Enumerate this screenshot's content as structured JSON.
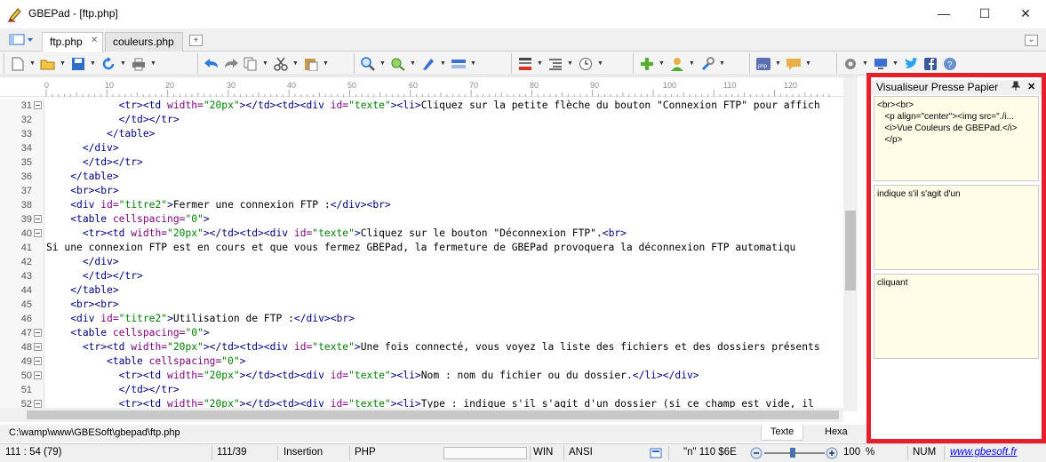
{
  "window": {
    "title": "GBEPad - [ftp.php]",
    "minimize_glyph": "—",
    "maximize_glyph": "☐",
    "close_glyph": "✕"
  },
  "tabs": [
    {
      "label": "ftp.php",
      "active": true,
      "close": "✕"
    },
    {
      "label": "couleurs.php",
      "active": false
    }
  ],
  "tab_add_glyph": "+",
  "tab_menu_glyph": "⌄",
  "ruler": {
    "marks": [
      "0",
      "10",
      "20",
      "30",
      "40",
      "50",
      "60",
      "70",
      "80",
      "90",
      "100",
      "110",
      "120"
    ]
  },
  "lines": [
    {
      "n": "31",
      "fold": true,
      "indent": "            ",
      "segments": [
        [
          "t",
          "<tr><td "
        ],
        [
          "a",
          "width="
        ],
        [
          "v",
          "\"20px\""
        ],
        [
          "t",
          "></td><td><div "
        ],
        [
          "a",
          "id="
        ],
        [
          "v",
          "\"texte\""
        ],
        [
          "t",
          "><li>"
        ],
        [
          "x",
          "Cliquez sur la petite flèche du bouton \"Connexion FTP\" pour affich"
        ]
      ]
    },
    {
      "n": "32",
      "fold": false,
      "indent": "            ",
      "segments": [
        [
          "t",
          "</td></tr>"
        ]
      ]
    },
    {
      "n": "33",
      "fold": false,
      "indent": "          ",
      "segments": [
        [
          "t",
          "</table>"
        ]
      ]
    },
    {
      "n": "34",
      "fold": false,
      "indent": "      ",
      "segments": [
        [
          "t",
          "</div>"
        ]
      ]
    },
    {
      "n": "35",
      "fold": false,
      "indent": "      ",
      "segments": [
        [
          "t",
          "</td></tr>"
        ]
      ]
    },
    {
      "n": "36",
      "fold": false,
      "indent": "    ",
      "segments": [
        [
          "t",
          "</table>"
        ]
      ]
    },
    {
      "n": "37",
      "fold": false,
      "indent": "    ",
      "segments": [
        [
          "t",
          "<br><br>"
        ]
      ]
    },
    {
      "n": "38",
      "fold": false,
      "indent": "    ",
      "segments": [
        [
          "t",
          "<div "
        ],
        [
          "a",
          "id="
        ],
        [
          "v",
          "\"titre2\""
        ],
        [
          "t",
          ">"
        ],
        [
          "x",
          "Fermer une connexion FTP :"
        ],
        [
          "t",
          "</div><br>"
        ]
      ]
    },
    {
      "n": "39",
      "fold": true,
      "indent": "    ",
      "segments": [
        [
          "t",
          "<table "
        ],
        [
          "a",
          "cellspacing="
        ],
        [
          "v",
          "\"0\""
        ],
        [
          "t",
          ">"
        ]
      ]
    },
    {
      "n": "40",
      "fold": true,
      "indent": "      ",
      "segments": [
        [
          "t",
          "<tr><td "
        ],
        [
          "a",
          "width="
        ],
        [
          "v",
          "\"20px\""
        ],
        [
          "t",
          "></td><td><div "
        ],
        [
          "a",
          "id="
        ],
        [
          "v",
          "\"texte\""
        ],
        [
          "t",
          ">"
        ],
        [
          "x",
          "Cliquez sur le bouton \"Déconnexion FTP\"."
        ],
        [
          "t",
          "<br>"
        ]
      ]
    },
    {
      "n": "41",
      "fold": false,
      "indent": "",
      "segments": [
        [
          "x",
          "Si une connexion FTP est en cours et que vous fermez GBEPad, la fermeture de GBEPad provoquera la déconnexion FTP automatiqu"
        ]
      ]
    },
    {
      "n": "42",
      "fold": false,
      "indent": "      ",
      "segments": [
        [
          "t",
          "</div>"
        ]
      ]
    },
    {
      "n": "43",
      "fold": false,
      "indent": "      ",
      "segments": [
        [
          "t",
          "</td></tr>"
        ]
      ]
    },
    {
      "n": "44",
      "fold": false,
      "indent": "    ",
      "segments": [
        [
          "t",
          "</table>"
        ]
      ]
    },
    {
      "n": "45",
      "fold": false,
      "indent": "    ",
      "segments": [
        [
          "t",
          "<br><br>"
        ]
      ]
    },
    {
      "n": "46",
      "fold": false,
      "indent": "    ",
      "segments": [
        [
          "t",
          "<div "
        ],
        [
          "a",
          "id="
        ],
        [
          "v",
          "\"titre2\""
        ],
        [
          "t",
          ">"
        ],
        [
          "x",
          "Utilisation de FTP :"
        ],
        [
          "t",
          "</div><br>"
        ]
      ]
    },
    {
      "n": "47",
      "fold": true,
      "indent": "    ",
      "segments": [
        [
          "t",
          "<table "
        ],
        [
          "a",
          "cellspacing="
        ],
        [
          "v",
          "\"0\""
        ],
        [
          "t",
          ">"
        ]
      ]
    },
    {
      "n": "48",
      "fold": true,
      "indent": "      ",
      "segments": [
        [
          "t",
          "<tr><td "
        ],
        [
          "a",
          "width="
        ],
        [
          "v",
          "\"20px\""
        ],
        [
          "t",
          "></td><td><div "
        ],
        [
          "a",
          "id="
        ],
        [
          "v",
          "\"texte\""
        ],
        [
          "t",
          ">"
        ],
        [
          "x",
          "Une fois connecté, vous voyez la liste des fichiers et des dossiers présents"
        ]
      ]
    },
    {
      "n": "49",
      "fold": true,
      "indent": "          ",
      "segments": [
        [
          "t",
          "<table "
        ],
        [
          "a",
          "cellspacing="
        ],
        [
          "v",
          "\"0\""
        ],
        [
          "t",
          ">"
        ]
      ]
    },
    {
      "n": "50",
      "fold": true,
      "indent": "            ",
      "segments": [
        [
          "t",
          "<tr><td "
        ],
        [
          "a",
          "width="
        ],
        [
          "v",
          "\"20px\""
        ],
        [
          "t",
          "></td><td><div "
        ],
        [
          "a",
          "id="
        ],
        [
          "v",
          "\"texte\""
        ],
        [
          "t",
          "><li>"
        ],
        [
          "x",
          "Nom : nom du fichier ou du dossier."
        ],
        [
          "t",
          "</li></div>"
        ]
      ]
    },
    {
      "n": "51",
      "fold": false,
      "indent": "            ",
      "segments": [
        [
          "t",
          "</td></tr>"
        ]
      ]
    },
    {
      "n": "52",
      "fold": true,
      "indent": "            ",
      "segments": [
        [
          "t",
          "<tr><td "
        ],
        [
          "a",
          "width="
        ],
        [
          "v",
          "\"20px\""
        ],
        [
          "t",
          "></td><td><div "
        ],
        [
          "a",
          "id="
        ],
        [
          "v",
          "\"texte\""
        ],
        [
          "t",
          "><li>"
        ],
        [
          "x",
          "Type : indique s'il s'agit d'un dossier (si ce champ est vide, il"
        ]
      ]
    }
  ],
  "path": "C:\\wamp\\www\\GBESoft\\gbepad\\ftp.php",
  "view_modes": [
    "Texte",
    "Hexa"
  ],
  "clipboard_panel": {
    "title": "Visualiseur Presse Papier",
    "pin_glyph": "📌",
    "close_glyph": "✕",
    "items": [
      {
        "lines": [
          "<br><br>",
          "   <p align=\"center\"><img src=\"./i...",
          "   <i>Vue Couleurs de GBEPad.</i>",
          "   </p>"
        ]
      },
      {
        "lines": [
          "indique s'il s'agit d'un"
        ]
      },
      {
        "lines": [
          "cliquant"
        ]
      }
    ]
  },
  "status": {
    "position": "111 : 54 (79)",
    "lines": "111/39",
    "mode": "Insertion",
    "language": "PHP",
    "eol": "WIN",
    "encoding": "ANSI",
    "char_info": "\"n\" 110 $6E",
    "zoom": "100",
    "zoom_unit": "%",
    "num": "NUM",
    "website": "www.gbesoft.fr"
  },
  "colors": {
    "accent_panel_border": "#e5202a",
    "tag": "#000080",
    "attr": "#7f007f",
    "value": "#007f00"
  }
}
